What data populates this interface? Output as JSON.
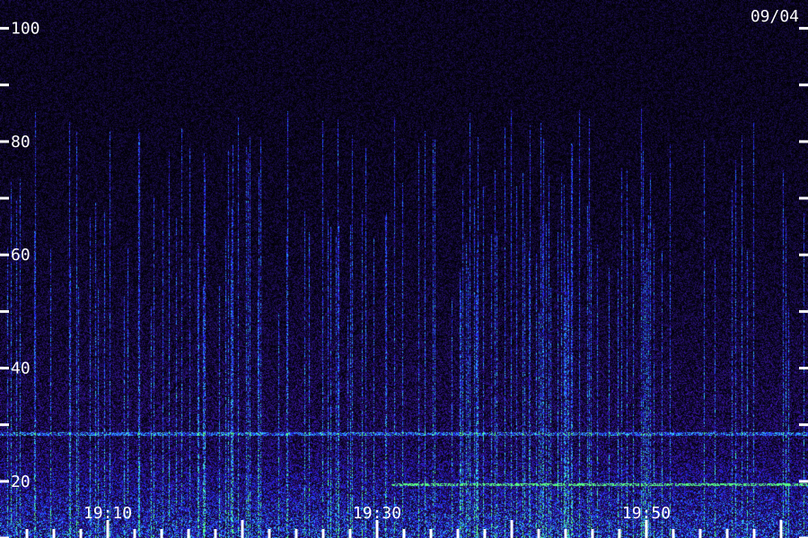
{
  "chart_data": {
    "type": "heatmap",
    "date": "09/04",
    "y_ticks": [
      100,
      80,
      60,
      40,
      20
    ],
    "ylim": [
      10,
      105
    ],
    "x_ticks": [
      "19:10",
      "19:30",
      "19:50"
    ],
    "x_tick_minutes": [
      10,
      30,
      50
    ],
    "xlim_minutes": [
      2,
      62
    ],
    "colormap": [
      "#000000",
      "#1e0f5a",
      "#3a14a8",
      "#1e28ff",
      "#2a8cff",
      "#3ff2ff",
      "#5cff6a"
    ],
    "features": {
      "persistent_line_y": 28.5,
      "green_line_y": 19.5,
      "green_line_start_minute": 31
    },
    "grid": false,
    "legend": "none"
  }
}
